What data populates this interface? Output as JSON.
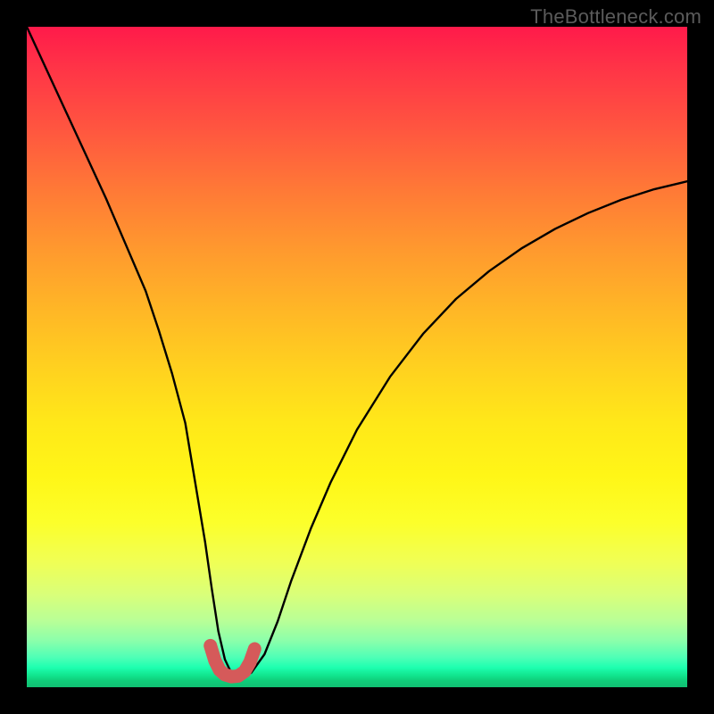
{
  "watermark": "TheBottleneck.com",
  "colors": {
    "background": "#000000",
    "curve_line": "#000000",
    "bottom_accent": "#d55a5a",
    "gradient_top": "#ff1a4a",
    "gradient_mid": "#ffe819",
    "gradient_bottom": "#11bf72"
  },
  "chart_data": {
    "type": "line",
    "title": "",
    "xlabel": "",
    "ylabel": "",
    "xlim": [
      0,
      100
    ],
    "ylim": [
      0,
      100
    ],
    "grid": false,
    "legend": false,
    "series": [
      {
        "name": "bottleneck-curve",
        "x": [
          0,
          3,
          6,
          9,
          12,
          15,
          18,
          20,
          22,
          24,
          25.5,
          27,
          28,
          29,
          30,
          31,
          32.5,
          34,
          36,
          38,
          40,
          43,
          46,
          50,
          55,
          60,
          65,
          70,
          75,
          80,
          85,
          90,
          95,
          100
        ],
        "y": [
          100,
          93.5,
          87,
          80.5,
          74,
          67,
          60,
          54,
          47.5,
          40,
          31,
          22,
          15,
          8.5,
          4.2,
          2.1,
          1.4,
          2.2,
          5,
          10,
          16,
          24,
          31,
          39,
          47,
          53.5,
          58.8,
          63,
          66.5,
          69.4,
          71.8,
          73.8,
          75.4,
          76.6
        ]
      },
      {
        "name": "optimal-zone-marker",
        "x": [
          27.8,
          28.5,
          29.2,
          30.0,
          31.0,
          32.0,
          33.0,
          33.8,
          34.5
        ],
        "y": [
          6.3,
          4.0,
          2.6,
          1.9,
          1.6,
          1.7,
          2.4,
          3.8,
          5.8
        ]
      }
    ],
    "annotations": []
  }
}
